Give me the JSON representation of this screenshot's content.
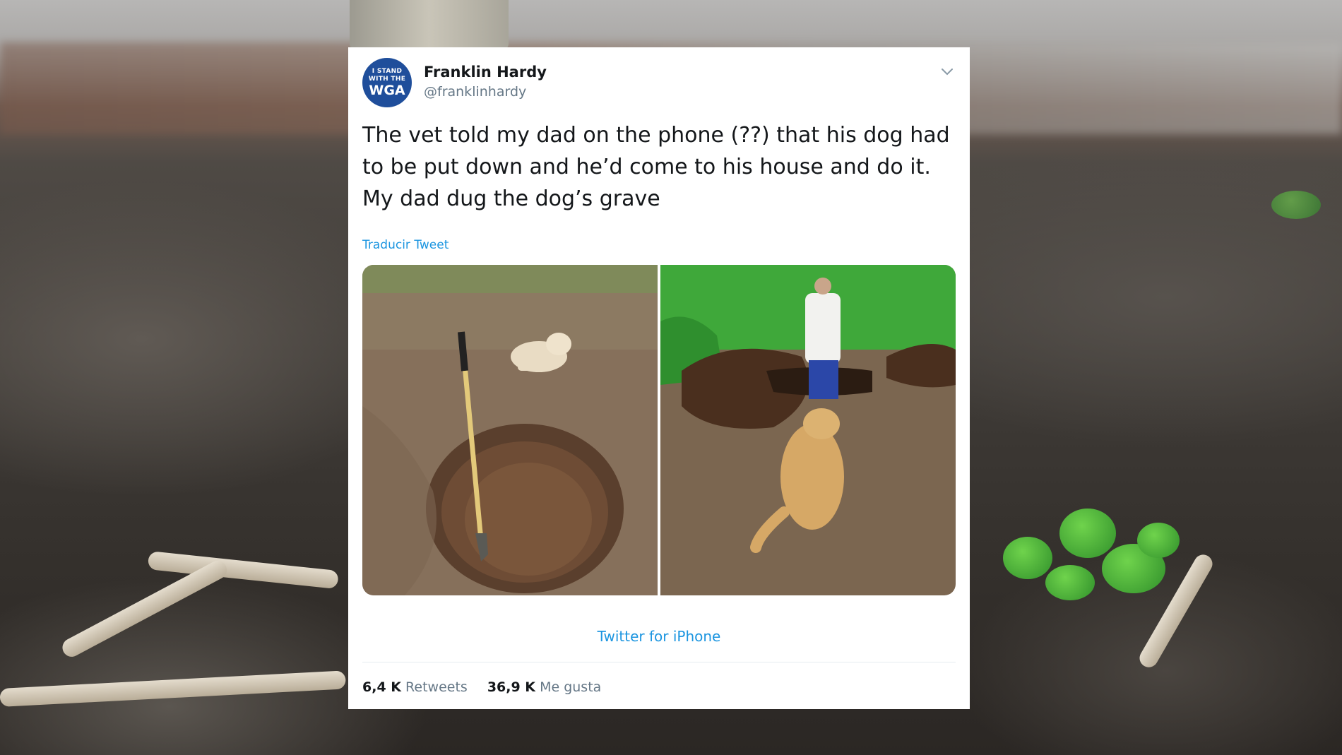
{
  "tweet": {
    "avatar_line1": "I STAND WITH THE",
    "avatar_line2": "WGA",
    "display_name": "Franklin Hardy",
    "handle": "@franklinhardy",
    "text": "The vet told my dad on the phone (??) that his dog had to be put down and he’d come to his house and do it. My dad dug the dog’s grave",
    "translate_label": "Traducir Tweet",
    "source": "Twitter for iPhone",
    "retweets_count": "6,4 K",
    "retweets_label": "Retweets",
    "likes_count": "36,9 K",
    "likes_label": "Me gusta",
    "menu_icon": "chevron-down-icon"
  },
  "media": [
    {
      "name": "photo-dog-beside-grave-with-shovel"
    },
    {
      "name": "photo-man-digging-grave-dog-watching"
    }
  ],
  "colors": {
    "link": "#1b95e0",
    "text": "#14171a",
    "secondary": "#657786",
    "avatar_bg": "#1f4e9b"
  }
}
